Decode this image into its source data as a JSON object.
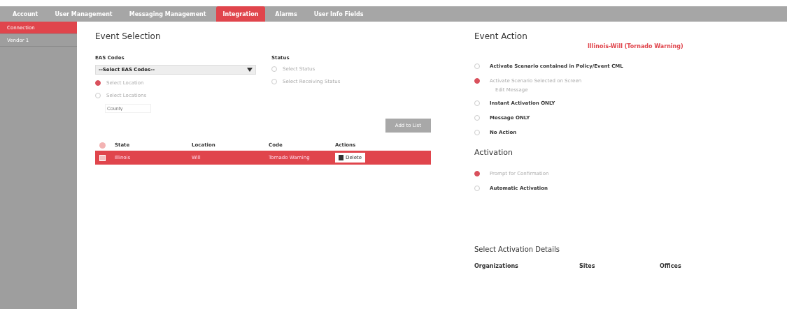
{
  "nav_tabs": [
    {
      "label": "Account",
      "selected": false
    },
    {
      "label": "User Management",
      "selected": false
    },
    {
      "label": "Messaging Management",
      "selected": false
    },
    {
      "label": "Integration",
      "selected": true
    },
    {
      "label": "Alarms",
      "selected": false
    },
    {
      "label": "User Info Fields",
      "selected": false
    }
  ],
  "sidebar": {
    "items": [
      {
        "label": "Connection",
        "selected": true
      },
      {
        "label": "Vendor 1",
        "selected": false
      }
    ]
  },
  "event_selection": {
    "title": "Event Selection",
    "eas_codes": {
      "label": "EAS Codes",
      "value": "--Select EAS Codes--"
    },
    "location_options": [
      {
        "label": "Select Location",
        "selected": true
      },
      {
        "label": "Select Locations",
        "selected": false
      }
    ],
    "location_field": {
      "placeholder": "County"
    },
    "status": {
      "label": "Status",
      "options": [
        {
          "label": "Select Status",
          "selected": false
        },
        {
          "label": "Select Receiving Status",
          "selected": false
        }
      ]
    },
    "add_button": "Add to List",
    "table": {
      "columns": [
        "State",
        "Location",
        "Code",
        "Actions"
      ],
      "rows": [
        {
          "checked": true,
          "selected": true,
          "cells": [
            "Illinois",
            "Will",
            "Tornado Warning"
          ],
          "action": "Delete"
        }
      ]
    }
  },
  "event_action": {
    "title": "Event Action",
    "event": "Illinois-Will (Tornado Warning)",
    "options": [
      {
        "label": "Activate Scenario contained in Policy/Event CML",
        "selected": false
      },
      {
        "label": "Activate Scenario Selected on Screen",
        "selected": true,
        "link": "Edit Message"
      },
      {
        "label": "Instant Activation ONLY",
        "selected": false
      },
      {
        "label": "Message ONLY",
        "selected": false
      },
      {
        "label": "No Action",
        "selected": false
      }
    ]
  },
  "activation": {
    "title": "Activation",
    "options": [
      {
        "label": "Prompt for Confirmation",
        "selected": true
      },
      {
        "label": "Automatic Activation",
        "selected": false
      }
    ]
  },
  "activation_details": {
    "title": "Select Activation Details",
    "columns": [
      "Organizations",
      "Sites",
      "Offices"
    ]
  }
}
